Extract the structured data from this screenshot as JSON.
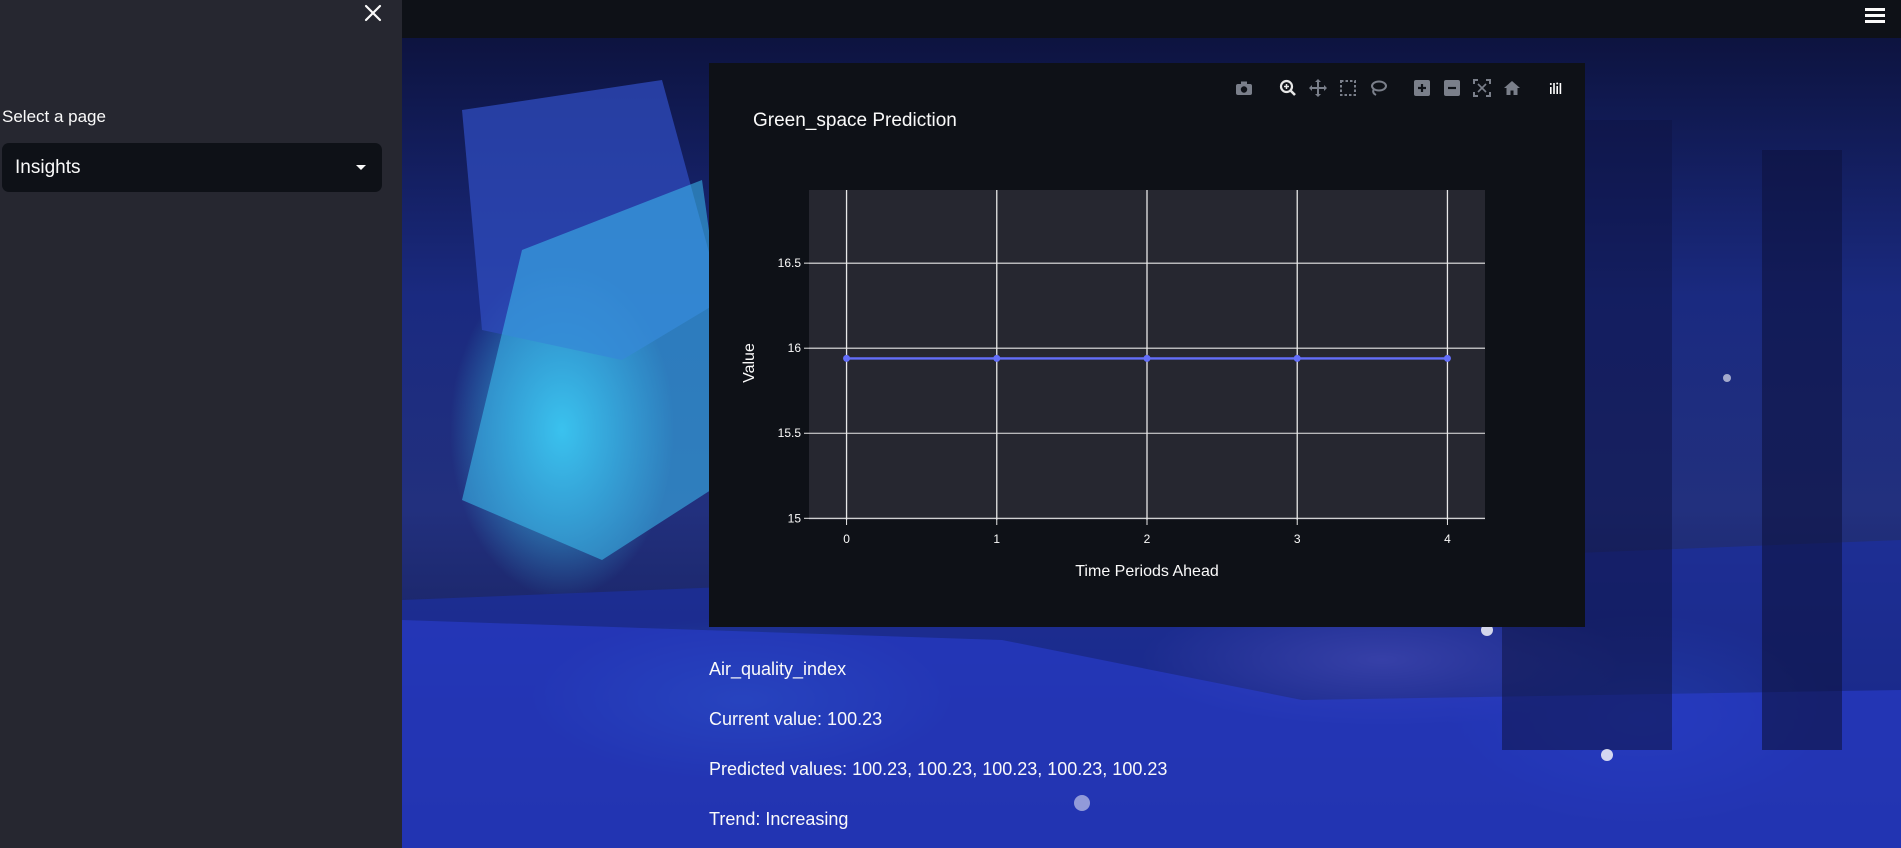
{
  "sidebar": {
    "close_icon": "close-icon",
    "select_label": "Select a page",
    "select_value": "Insights"
  },
  "header": {
    "menu_icon": "hamburger-menu-icon"
  },
  "chart_card": {
    "modebar_icons": [
      "camera-icon",
      "zoom-icon",
      "pan-icon",
      "box-select-icon",
      "lasso-select-icon",
      "zoom-in-icon",
      "zoom-out-icon",
      "autoscale-icon",
      "reset-axes-icon",
      "plotly-logo-icon"
    ],
    "fullscreen_icon": "fullscreen-icon"
  },
  "chart_data": {
    "type": "line",
    "title": "Green_space Prediction",
    "xlabel": "Time Periods Ahead",
    "ylabel": "Value",
    "x": [
      0,
      1,
      2,
      3,
      4
    ],
    "series": [
      {
        "values": [
          15.94,
          15.94,
          15.94,
          15.94,
          15.94
        ],
        "color": "#636efa"
      }
    ],
    "xlim": [
      -0.25,
      4.25
    ],
    "ylim": [
      14.99,
      16.93
    ],
    "xticks": [
      "0",
      "1",
      "2",
      "3",
      "4"
    ],
    "yticks": [
      "15",
      "15.5",
      "16",
      "16.5"
    ],
    "grid": true
  },
  "info": {
    "metric_name": "Air_quality_index",
    "current": "Current value: 100.23",
    "predicted": "Predicted values: 100.23, 100.23, 100.23, 100.23, 100.23",
    "trend": "Trend: Increasing"
  }
}
